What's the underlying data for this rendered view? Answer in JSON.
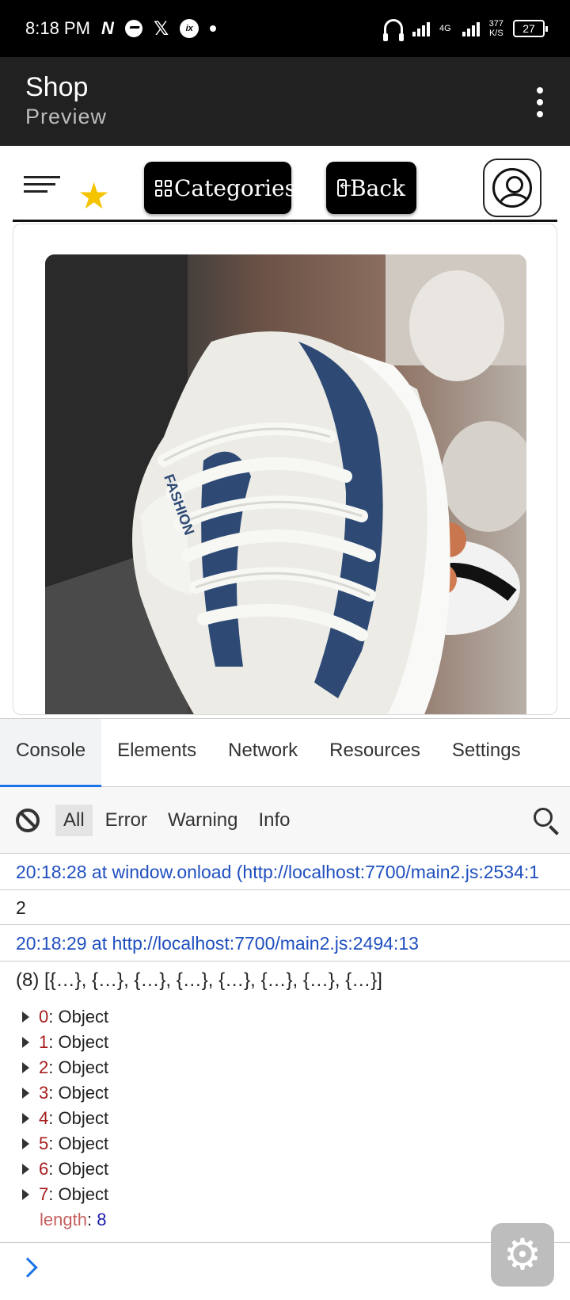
{
  "status_bar": {
    "time": "8:18 PM",
    "network": "4G",
    "speed_value": "377",
    "speed_unit": "K/S",
    "battery": "27"
  },
  "app_bar": {
    "title": "Shop",
    "subtitle": "Preview",
    "menu_icon": "more-vert-icon"
  },
  "web_nav": {
    "categories_label": "Categories",
    "back_label": "Back",
    "star_color": "#f5c400"
  },
  "product": {
    "image_alt": "sneaker-photo",
    "brand_text": "FASHION"
  },
  "console": {
    "tabs": [
      "Console",
      "Elements",
      "Network",
      "Resources",
      "Settings"
    ],
    "active_tab": "Console",
    "filters": [
      "All",
      "Error",
      "Warning",
      "Info"
    ],
    "active_filter": "All",
    "logs": {
      "source1": "20:18:28 at window.onload (http://localhost:7700/main2.js:2534:1",
      "value1": "2",
      "source2": "20:18:29 at http://localhost:7700/main2.js:2494:13",
      "array_summary": "(8) [{…}, {…}, {…}, {…}, {…}, {…}, {…}, {…}]",
      "items": [
        {
          "key": "0",
          "val": "Object"
        },
        {
          "key": "1",
          "val": "Object"
        },
        {
          "key": "2",
          "val": "Object"
        },
        {
          "key": "3",
          "val": "Object"
        },
        {
          "key": "4",
          "val": "Object"
        },
        {
          "key": "5",
          "val": "Object"
        },
        {
          "key": "6",
          "val": "Object"
        },
        {
          "key": "7",
          "val": "Object"
        }
      ],
      "length_key": "length",
      "length_value": "8"
    },
    "accent_color": "#1a73e8"
  }
}
